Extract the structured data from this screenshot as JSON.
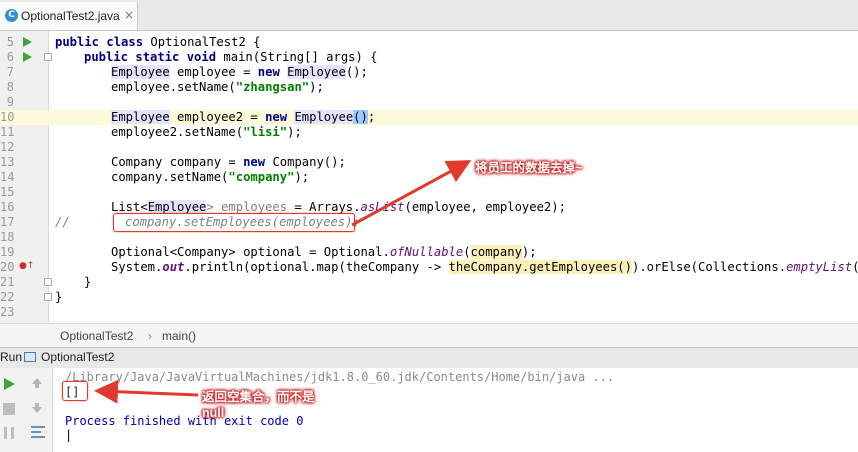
{
  "tab": {
    "icon": "C",
    "label": "OptionalTest2.java",
    "close": "×"
  },
  "lines": [
    {
      "no": "5"
    },
    {
      "no": "6"
    },
    {
      "no": "7"
    },
    {
      "no": "8"
    },
    {
      "no": "9"
    },
    {
      "no": "10"
    },
    {
      "no": "11"
    },
    {
      "no": "12"
    },
    {
      "no": "13"
    },
    {
      "no": "14"
    },
    {
      "no": "15"
    },
    {
      "no": "16"
    },
    {
      "no": "17"
    },
    {
      "no": "18"
    },
    {
      "no": "19"
    },
    {
      "no": "20"
    },
    {
      "no": "21"
    },
    {
      "no": "22"
    },
    {
      "no": "23"
    }
  ],
  "code": {
    "l5_kw": "public class ",
    "l5_rest": "OptionalTest2 {",
    "l6_kw": "public static void ",
    "l6_rest": "main(String[] args) {",
    "l7_t": "Employee",
    "l7_a": " employee = ",
    "l7_kw": "new ",
    "l7_t2": "Employee",
    "l7_b": "();",
    "l8_a": "employee.setName(",
    "l8_s": "\"zhangsan\"",
    "l8_b": ");",
    "l10_t": "Employee",
    "l10_a": " employee2 = ",
    "l10_kw": "new ",
    "l10_t2": "Employee",
    "l10_p1": "(",
    "l10_p2": ")",
    "l10_b": ";",
    "l11_a": "employee2.setName(",
    "l11_s": "\"lisi\"",
    "l11_b": ");",
    "l13_a": "Company company = ",
    "l13_kw": "new ",
    "l13_b": "Company();",
    "l14_a": "company.setName(",
    "l14_s": "\"company\"",
    "l14_b": ");",
    "l16_a": "List<",
    "l16_t": "Employee",
    "l16_g": "> employees",
    "l16_b": " = Arrays.",
    "l16_m": "asList",
    "l16_c": "(employee, employee2);",
    "l17_slash": "//",
    "l17_cm": "company.setEmployees(employees);",
    "l19_a": "Optional<Company> optional = Optional.",
    "l19_m": "ofNullable",
    "l19_p1": "(",
    "l19_v": "company",
    "l19_p2": ");",
    "l20_a": "System.",
    "l20_f": "out",
    "l20_b": ".println(optional.map(theCompany -> ",
    "l20_l": "theCompany.getEmployees()",
    "l20_c": ").orElse(Collections.",
    "l20_m": "emptyList",
    "l20_d": "()));",
    "l21": "}",
    "l22": "}"
  },
  "breadcrumb": {
    "class": "OptionalTest2",
    "sep": "›",
    "method": "main()"
  },
  "run": {
    "label": "Run",
    "config": "OptionalTest2"
  },
  "console": {
    "cmd": "/Library/Java/JavaVirtualMachines/jdk1.8.0_60.jdk/Contents/Home/bin/java ...",
    "output": "[]",
    "finished": "Process finished with exit code 0",
    "cursor": "|"
  },
  "annotations": {
    "remove_employees": "将员工的数据去掉~",
    "returns_empty_1": "返回空集合，而不是",
    "returns_empty_2": "null"
  },
  "colors": {
    "annotation": "#e03a2f",
    "keyword": "#000080",
    "string": "#008000",
    "run_green": "#3aa53a",
    "console_text": "#0000b0"
  }
}
